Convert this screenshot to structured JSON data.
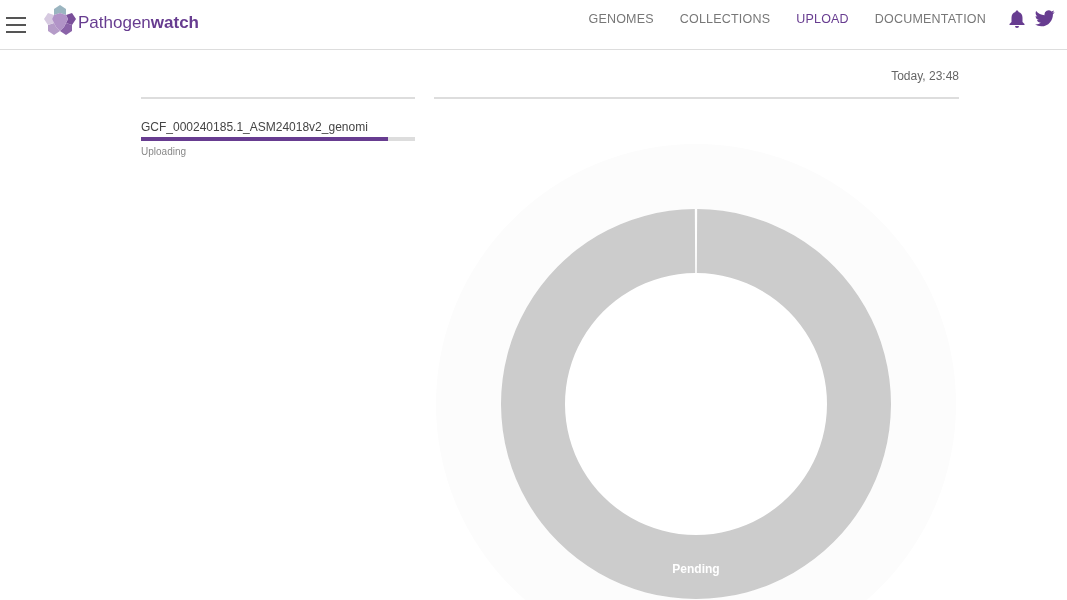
{
  "header": {
    "logo_text": "Pathogen**watch**",
    "nav": [
      {
        "label": "GENOMES",
        "selected": false
      },
      {
        "label": "COLLECTIONS",
        "selected": false
      },
      {
        "label": "UPLOAD",
        "selected": true
      },
      {
        "label": "DOCUMENTATION",
        "selected": false
      }
    ]
  },
  "upload": {
    "timestamp": "Today, 23:48",
    "files": [
      {
        "name": "GCF_000240185.1_ASM24018v2_genomi",
        "status": "Uploading",
        "level": 0.9
      }
    ]
  },
  "status_chart": {
    "segments": [
      {
        "label": "Pending"
      }
    ]
  }
}
